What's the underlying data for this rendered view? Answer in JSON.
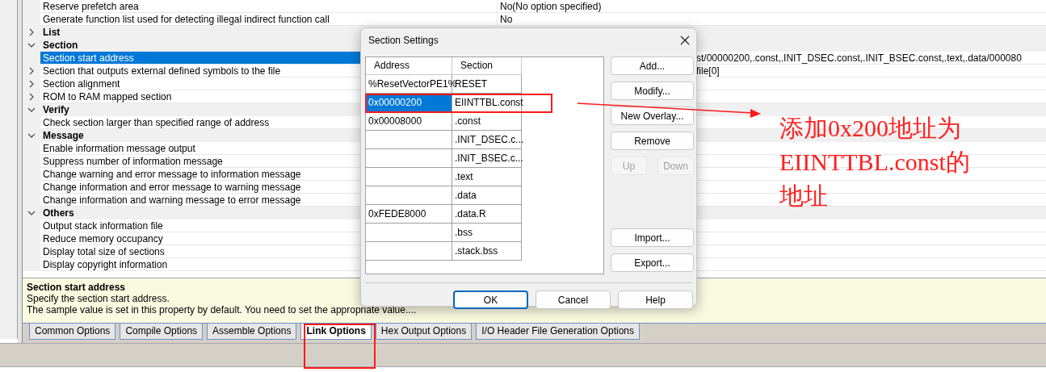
{
  "property_grid": {
    "rows": [
      {
        "kind": "property",
        "label": "Reserve prefetch area",
        "value": "No(No option specified)",
        "selected": false
      },
      {
        "kind": "property",
        "label": "Generate function list used for detecting illegal indirect function call",
        "value": "No",
        "selected": false
      },
      {
        "kind": "category",
        "label": "List",
        "expanded": false
      },
      {
        "kind": "category",
        "label": "Section",
        "expanded": true,
        "children": [
          {
            "kind": "property",
            "label": "Section start address",
            "value": "st/00000200,.const,.INIT_DSEC.const,.INIT_BSEC.const,.text,.data/000080",
            "partly_covered": true,
            "selected": true
          },
          {
            "kind": "property",
            "label": "Section that outputs external defined symbols to the file",
            "value": "file[0]",
            "partly_covered": true,
            "expanded": false,
            "selected": false
          },
          {
            "kind": "property",
            "label": "Section alignment",
            "expanded": false,
            "selected": false
          },
          {
            "kind": "property",
            "label": "ROM to RAM mapped section",
            "expanded": false,
            "selected": false
          }
        ]
      },
      {
        "kind": "category",
        "label": "Verify",
        "expanded": true,
        "children": [
          {
            "kind": "property",
            "label": "Check section larger than specified range of address",
            "selected": false
          }
        ]
      },
      {
        "kind": "category",
        "label": "Message",
        "expanded": true,
        "children": [
          {
            "kind": "property",
            "label": "Enable information message output",
            "selected": false
          },
          {
            "kind": "property",
            "label": "Suppress number of information message",
            "selected": false
          },
          {
            "kind": "property",
            "label": "Change warning and error message to information message",
            "selected": false
          },
          {
            "kind": "property",
            "label": "Change information and error message to warning message",
            "selected": false
          },
          {
            "kind": "property",
            "label": "Change information and warning message to error message",
            "selected": false
          }
        ]
      },
      {
        "kind": "category",
        "label": "Others",
        "expanded": true,
        "children": [
          {
            "kind": "property",
            "label": "Output stack information file",
            "selected": false
          },
          {
            "kind": "property",
            "label": "Reduce memory occupancy",
            "selected": false
          },
          {
            "kind": "property",
            "label": "Display total size of sections",
            "selected": false
          },
          {
            "kind": "property",
            "label": "Display copyright information",
            "selected": false
          }
        ]
      }
    ]
  },
  "description": {
    "title": "Section start address",
    "lines": [
      "Specify the section start address.",
      "The sample value is set in this property by default. You need to set the appropriate value...."
    ]
  },
  "tabs": [
    {
      "label": "Common Options",
      "selected": false
    },
    {
      "label": "Compile Options",
      "selected": false
    },
    {
      "label": "Assemble Options",
      "selected": false
    },
    {
      "label": "Link Options",
      "selected": true
    },
    {
      "label": "Hex Output Options",
      "selected": false
    },
    {
      "label": "I/O Header File Generation Options",
      "selected": false
    }
  ],
  "dialog": {
    "title": "Section Settings",
    "columns": [
      "Address",
      "Section"
    ],
    "rows": [
      {
        "address": "%ResetVectorPE1%",
        "section": "RESET",
        "selected": false
      },
      {
        "address": "0x00000200",
        "section": "EIINTTBL.const",
        "selected": true
      },
      {
        "address": "0x00008000",
        "section": ".const",
        "selected": false
      },
      {
        "section": ".INIT_DSEC.c...",
        "selected": false
      },
      {
        "section": ".INIT_BSEC.c...",
        "selected": false
      },
      {
        "section": ".text",
        "selected": false
      },
      {
        "section": ".data",
        "selected": false
      },
      {
        "address": "0xFEDE8000",
        "section": ".data.R",
        "selected": false
      },
      {
        "section": ".bss",
        "selected": false
      },
      {
        "section": ".stack.bss",
        "selected": false
      }
    ],
    "side_buttons": [
      {
        "label": "Add...",
        "disabled": false
      },
      {
        "label": "Modify...",
        "disabled": false
      },
      {
        "label": "New Overlay...",
        "disabled": false
      },
      {
        "label": "Remove",
        "disabled": false
      },
      {
        "label": "Up",
        "disabled": true
      },
      {
        "label": "Down",
        "disabled": true
      },
      {
        "label": "Import...",
        "disabled": false
      },
      {
        "label": "Export...",
        "disabled": false
      }
    ],
    "bottom_buttons": [
      {
        "label": "OK",
        "default": true
      },
      {
        "label": "Cancel",
        "default": false
      },
      {
        "label": "Help",
        "default": false
      }
    ]
  },
  "annotation": {
    "lines": [
      "添加0x200地址为",
      "EIINTTBL.const的",
      "地址"
    ]
  }
}
